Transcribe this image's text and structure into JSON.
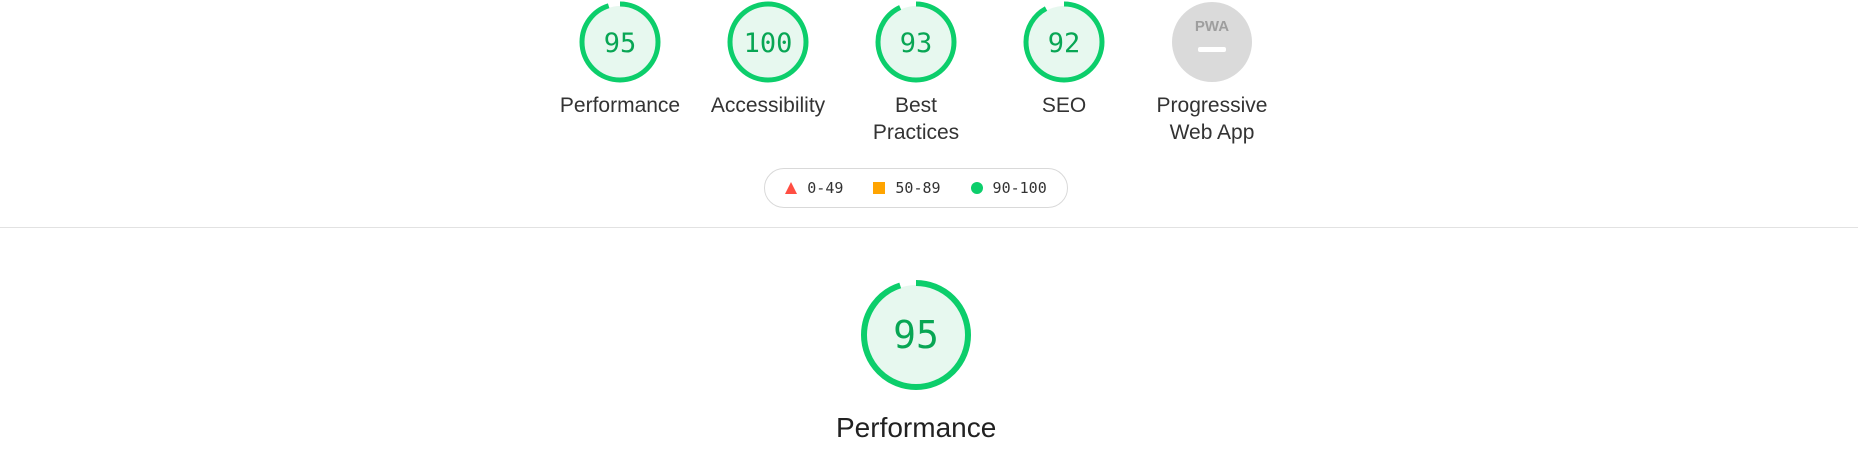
{
  "categories": [
    {
      "id": "performance",
      "label": "Performance",
      "score": "95",
      "fraction": 0.95
    },
    {
      "id": "accessibility",
      "label": "Accessibility",
      "score": "100",
      "fraction": 1.0
    },
    {
      "id": "best-practices",
      "label": "Best Practices",
      "score": "93",
      "fraction": 0.93
    },
    {
      "id": "seo",
      "label": "SEO",
      "score": "92",
      "fraction": 0.92
    }
  ],
  "pwa": {
    "label": "Progressive Web App",
    "badge_text": "PWA"
  },
  "legend": [
    {
      "range": "0-49",
      "shape": "triangle",
      "color": "#ff4e42"
    },
    {
      "range": "50-89",
      "shape": "square",
      "color": "#ffa400"
    },
    {
      "range": "90-100",
      "shape": "circle",
      "color": "#0cce6b"
    }
  ],
  "main_gauge": {
    "label": "Performance",
    "score": "95",
    "fraction": 0.95
  },
  "colors": {
    "pass": "#0cce6b",
    "pass_fill": "#e7f8ef",
    "pass_text": "#08a654",
    "pwa_gray": "#dadada",
    "pwa_text": "#9e9e9e"
  }
}
